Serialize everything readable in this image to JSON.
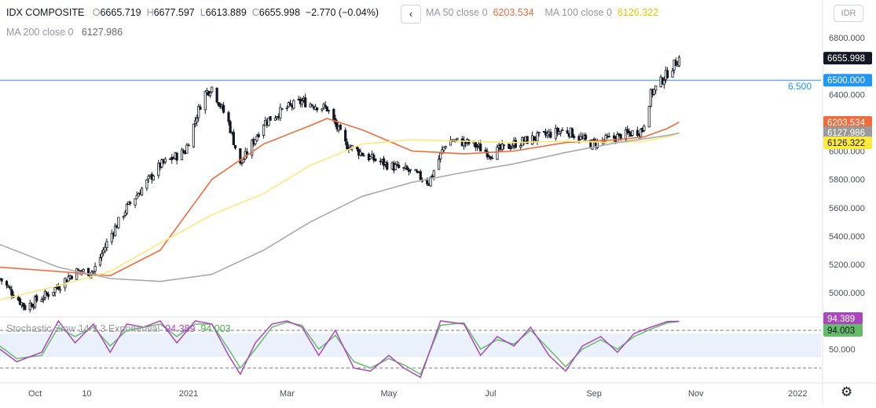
{
  "header": {
    "symbol": "IDX COMPOSITE",
    "open_label": "O",
    "open": "6665.719",
    "high_label": "H",
    "high": "6677.597",
    "low_label": "L",
    "low": "6613.889",
    "close_label": "C",
    "close": "6655.998",
    "change": "−2.770 (−0.04%)",
    "collapse_icon": "chevron-left-icon",
    "ma50_label": "MA 50 close 0",
    "ma50_value": "6203.534",
    "ma100_label": "MA 100 close 0",
    "ma100_value": "6126.322",
    "ma200_label": "MA 200 close 0",
    "ma200_value": "6127.986",
    "currency_button": "IDR"
  },
  "oscillator": {
    "label": "Stochastic Slow 14 3 3 Exponential",
    "k_value": "94.389",
    "d_value": "94.003"
  },
  "colors": {
    "candles": "#131722",
    "ma50": "#ef6c3d",
    "ma100": "#ffe97a",
    "ma200": "#aaaaaa",
    "hline": "#2196f3",
    "stoch_k": "#ab47bc",
    "stoch_d": "#66bb6a",
    "stoch_band": "#eaf1fb"
  },
  "settings_icon": "gear-icon",
  "chart_data": {
    "type": "candlestick",
    "y_axis": {
      "ticks": [
        5000,
        5200,
        5400,
        5600,
        5800,
        6000,
        6200,
        6400,
        6800
      ],
      "tick_labels": [
        "5000.000",
        "5200.000",
        "5400.000",
        "5600.000",
        "5800.000",
        "6000.000",
        "6200.000",
        "6400.000",
        "6800.000"
      ],
      "range": [
        4840,
        6900
      ]
    },
    "x_axis": {
      "tick_labels": [
        "Oct",
        "10",
        "2021",
        "Mar",
        "May",
        "Jul",
        "Sep",
        "Nov",
        "2022"
      ],
      "range": [
        "2020-09-10",
        "2022-01-15"
      ]
    },
    "horizontal_line": {
      "value": 6500,
      "label": "6.500",
      "axis_label": "6500.000"
    },
    "last_price": {
      "value": 6655.998,
      "label": "6655.998"
    },
    "price_tags": [
      {
        "series": "ma50",
        "value": 6203.534,
        "label": "6203.534"
      },
      {
        "series": "ma200",
        "value": 6127.986,
        "label": "6127.986"
      },
      {
        "series": "ma100",
        "value": 6126.322,
        "label": "6126.322"
      }
    ],
    "close_path": {
      "dates": [
        "2020-09-10",
        "2020-09-25",
        "2020-10-10",
        "2020-10-25",
        "2020-11-05",
        "2020-11-15",
        "2020-11-25",
        "2020-12-05",
        "2020-12-15",
        "2020-12-30",
        "2021-01-10",
        "2021-01-15",
        "2021-01-25",
        "2021-02-01",
        "2021-02-15",
        "2021-02-28",
        "2021-03-10",
        "2021-03-25",
        "2021-04-05",
        "2021-04-20",
        "2021-05-01",
        "2021-05-15",
        "2021-05-25",
        "2021-06-05",
        "2021-06-20",
        "2021-07-01",
        "2021-07-15",
        "2021-07-30",
        "2021-08-15",
        "2021-08-30",
        "2021-09-15",
        "2021-09-30",
        "2021-10-05",
        "2021-10-15",
        "2021-10-22"
      ],
      "values": [
        5100,
        4900,
        5000,
        5150,
        5150,
        5400,
        5600,
        5750,
        5900,
        6000,
        6400,
        6450,
        6200,
        5900,
        6200,
        6300,
        6350,
        6300,
        6050,
        5950,
        5900,
        5850,
        5780,
        6080,
        6050,
        5980,
        6050,
        6100,
        6150,
        6050,
        6100,
        6150,
        6400,
        6550,
        6656
      ]
    },
    "series": [
      {
        "name": "MA 50 close 0",
        "color_key": "ma50",
        "dates": [
          "2020-09-10",
          "2020-10-15",
          "2020-11-15",
          "2020-12-15",
          "2021-01-15",
          "2021-02-15",
          "2021-03-15",
          "2021-03-25",
          "2021-04-15",
          "2021-05-15",
          "2021-06-01",
          "2021-06-15",
          "2021-07-15",
          "2021-08-15",
          "2021-09-15",
          "2021-10-01",
          "2021-10-15",
          "2021-10-22"
        ],
        "values": [
          5180,
          5150,
          5120,
          5300,
          5800,
          6050,
          6180,
          6230,
          6150,
          6000,
          5990,
          5980,
          6000,
          6060,
          6080,
          6100,
          6160,
          6204
        ]
      },
      {
        "name": "MA 100 close 0",
        "color_key": "ma100",
        "dates": [
          "2020-09-10",
          "2020-10-15",
          "2020-11-15",
          "2020-12-15",
          "2021-01-15",
          "2021-02-15",
          "2021-03-15",
          "2021-04-15",
          "2021-05-15",
          "2021-06-15",
          "2021-07-15",
          "2021-08-15",
          "2021-09-15",
          "2021-10-01",
          "2021-10-15",
          "2021-10-22"
        ],
        "values": [
          4950,
          5050,
          5150,
          5350,
          5550,
          5700,
          5900,
          6050,
          6080,
          6070,
          6060,
          6070,
          6060,
          6070,
          6100,
          6126
        ]
      },
      {
        "name": "MA 200 close 0",
        "color_key": "ma200",
        "dates": [
          "2020-09-10",
          "2020-10-15",
          "2020-11-15",
          "2020-12-15",
          "2021-01-15",
          "2021-02-15",
          "2021-03-15",
          "2021-04-15",
          "2021-05-15",
          "2021-06-15",
          "2021-07-15",
          "2021-08-15",
          "2021-09-15",
          "2021-10-15",
          "2021-10-22"
        ],
        "values": [
          5340,
          5180,
          5100,
          5080,
          5130,
          5300,
          5500,
          5680,
          5780,
          5850,
          5910,
          5990,
          6060,
          6110,
          6128
        ]
      }
    ],
    "stochastic": {
      "label": "Stochastic Slow 14 3 3 Exponential",
      "tick_labels": [
        "50.000"
      ],
      "levels": [
        80,
        20
      ],
      "range": [
        0,
        100
      ],
      "k_last": 94.389,
      "d_last": 94.003,
      "dates": [
        "2020-09-10",
        "2020-09-20",
        "2020-10-05",
        "2020-10-15",
        "2020-10-25",
        "2020-11-05",
        "2020-11-15",
        "2020-11-25",
        "2020-12-05",
        "2020-12-15",
        "2020-12-25",
        "2021-01-05",
        "2021-01-15",
        "2021-01-25",
        "2021-02-01",
        "2021-02-10",
        "2021-02-20",
        "2021-03-01",
        "2021-03-10",
        "2021-03-20",
        "2021-03-30",
        "2021-04-10",
        "2021-04-20",
        "2021-05-01",
        "2021-05-10",
        "2021-05-20",
        "2021-06-01",
        "2021-06-15",
        "2021-06-25",
        "2021-07-05",
        "2021-07-15",
        "2021-07-25",
        "2021-08-05",
        "2021-08-15",
        "2021-08-25",
        "2021-09-05",
        "2021-09-15",
        "2021-09-25",
        "2021-10-05",
        "2021-10-15",
        "2021-10-22"
      ],
      "k": [
        50,
        30,
        45,
        95,
        60,
        90,
        45,
        90,
        85,
        95,
        60,
        95,
        90,
        40,
        10,
        60,
        90,
        95,
        85,
        40,
        80,
        20,
        15,
        40,
        20,
        5,
        95,
        90,
        40,
        70,
        55,
        85,
        40,
        15,
        55,
        70,
        45,
        75,
        85,
        94,
        94.389
      ],
      "d": [
        55,
        35,
        40,
        85,
        70,
        85,
        55,
        80,
        85,
        90,
        70,
        90,
        90,
        50,
        20,
        50,
        85,
        93,
        88,
        50,
        72,
        30,
        20,
        35,
        25,
        10,
        88,
        92,
        50,
        65,
        58,
        80,
        50,
        22,
        50,
        65,
        50,
        70,
        82,
        92,
        94.003
      ]
    }
  }
}
